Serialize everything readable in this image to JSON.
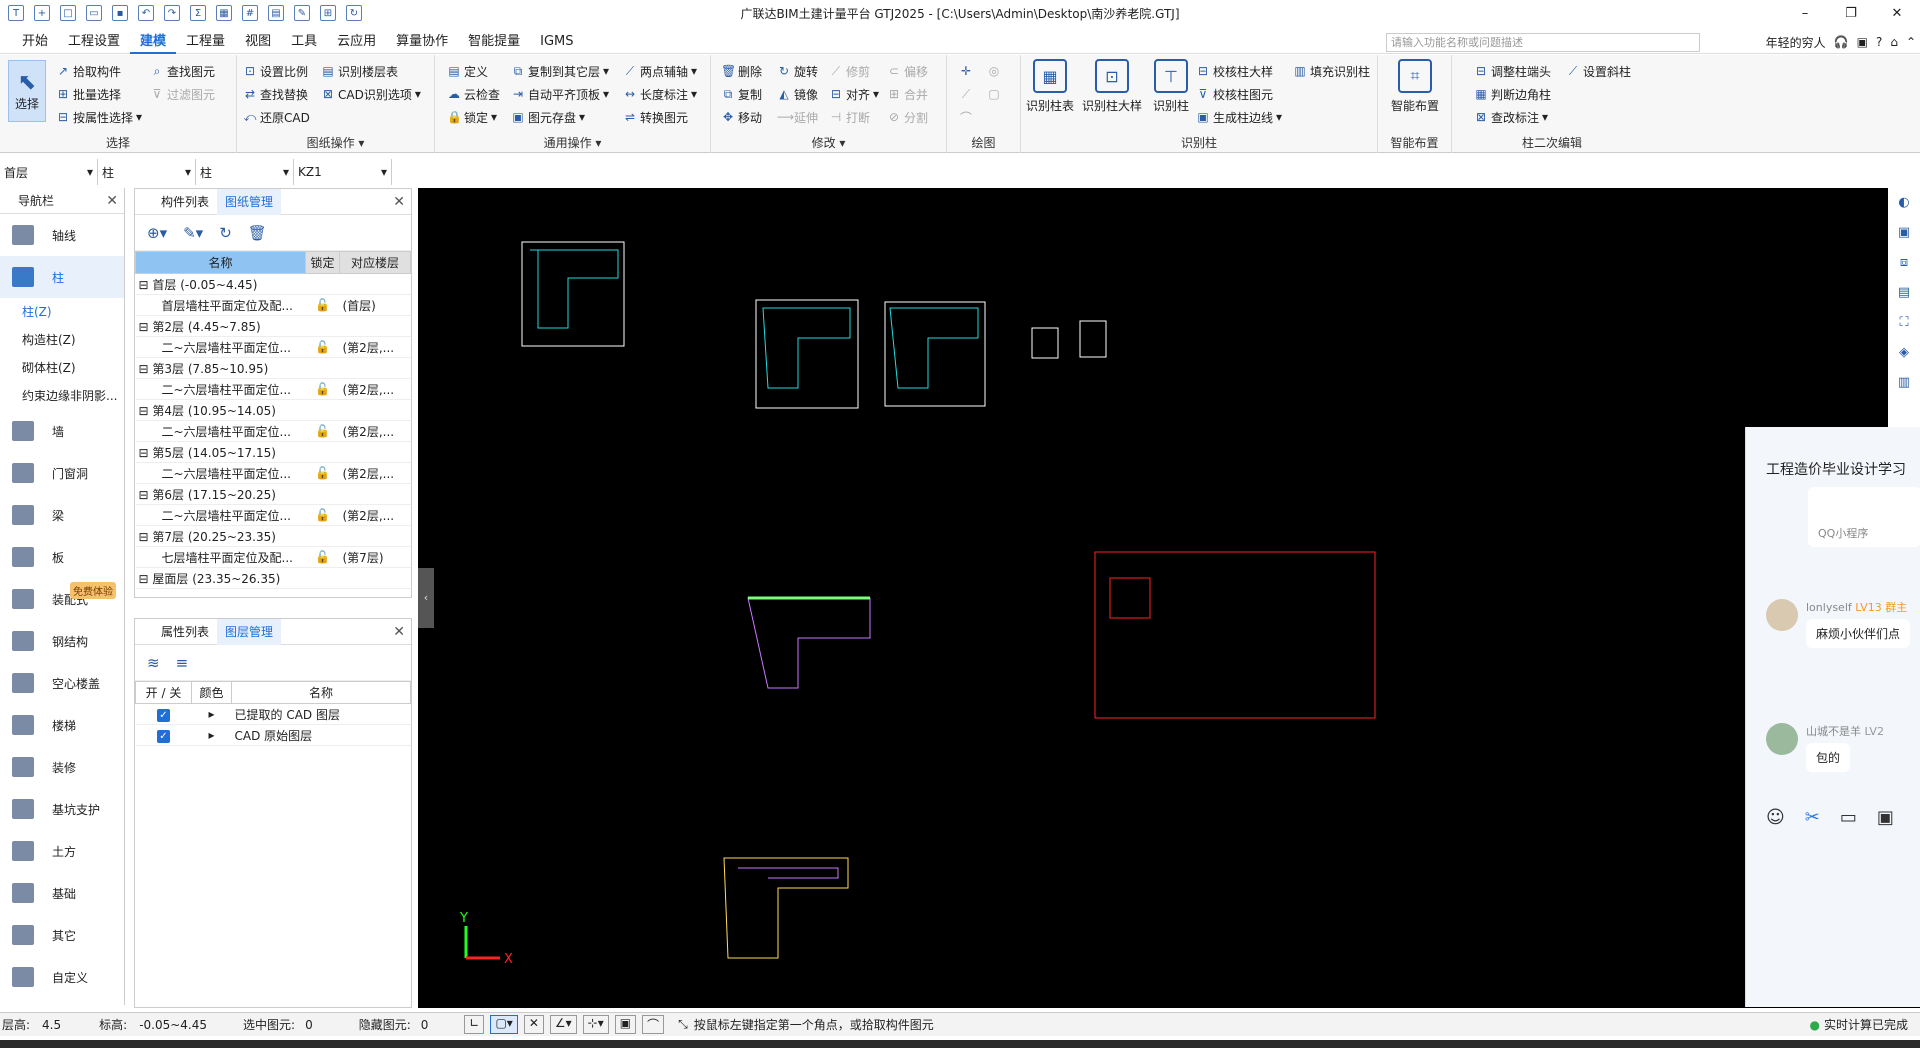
{
  "title": "广联达BIM土建计量平台 GTJ2025 - [C:\\Users\\Admin\\Desktop\\南沙养老院.GTJ]",
  "menu": [
    "开始",
    "工程设置",
    "建模",
    "工程量",
    "视图",
    "工具",
    "云应用",
    "算量协作",
    "智能提量",
    "IGMS"
  ],
  "search_placeholder": "请输入功能名称或问题描述",
  "user_name": "年轻的穷人",
  "ribbon": {
    "select_group": "选择",
    "select_big": "选择",
    "select_items": [
      "拾取构件",
      "批量选择",
      "按属性选择",
      "查找图元",
      "过滤图元"
    ],
    "drawing_group": "图纸操作",
    "drawing_items": [
      "设置比例",
      "识别楼层表",
      "查找替换",
      "CAD识别选项",
      "还原CAD"
    ],
    "common_group": "通用操作",
    "common_items": [
      "定义",
      "复制到其它层",
      "两点辅轴",
      "云检查",
      "自动平齐顶板",
      "长度标注",
      "锁定",
      "图元存盘",
      "转换图元"
    ],
    "modify_group": "修改",
    "modify_items": [
      "删除",
      "旋转",
      "修剪",
      "偏移",
      "复制",
      "镜像",
      "对齐",
      "合并",
      "移动",
      "延伸",
      "打断",
      "分割"
    ],
    "draw_group": "绘图",
    "recog_group": "识别柱",
    "recog_big": [
      "识别柱表",
      "识别柱大样",
      "识别柱"
    ],
    "recog_items": [
      "校核柱大样",
      "填充识别柱",
      "校核柱图元",
      "生成柱边线"
    ],
    "smart_group": "智能布置",
    "smart_big": "智能布置",
    "edit_group": "柱二次编辑",
    "edit_items": [
      "调整柱端头",
      "设置斜柱",
      "判断边角柱",
      "查改标注"
    ]
  },
  "dropdowns": [
    "首层",
    "柱",
    "柱",
    "KZ1"
  ],
  "nav": {
    "title": "导航栏",
    "top": [
      "轴线",
      "柱"
    ],
    "sub": [
      "柱(Z)",
      "构造柱(Z)",
      "砌体柱(Z)",
      "约束边缘非阴影..."
    ],
    "items": [
      "墙",
      "门窗洞",
      "梁",
      "板",
      "装配式",
      "钢结构",
      "空心楼盖",
      "楼梯",
      "装修",
      "基坑支护",
      "土方",
      "基础",
      "其它",
      "自定义"
    ],
    "badge": "免费体验"
  },
  "comp_tabs": [
    "构件列表",
    "图纸管理"
  ],
  "table_headers": [
    "名称",
    "锁定",
    "对应楼层"
  ],
  "table_rows": [
    {
      "name": "首层 (-0.05~4.45)",
      "lock": "",
      "floor": "",
      "group": true
    },
    {
      "name": "首层墙柱平面定位及配...",
      "lock": "🔓",
      "floor": "(首层)",
      "group": false
    },
    {
      "name": "第2层 (4.45~7.85)",
      "lock": "",
      "floor": "",
      "group": true
    },
    {
      "name": "二~六层墙柱平面定位...",
      "lock": "🔓",
      "floor": "(第2层,...",
      "group": false
    },
    {
      "name": "第3层 (7.85~10.95)",
      "lock": "",
      "floor": "",
      "group": true
    },
    {
      "name": "二~六层墙柱平面定位...",
      "lock": "🔓",
      "floor": "(第2层,...",
      "group": false
    },
    {
      "name": "第4层 (10.95~14.05)",
      "lock": "",
      "floor": "",
      "group": true
    },
    {
      "name": "二~六层墙柱平面定位...",
      "lock": "🔓",
      "floor": "(第2层,...",
      "group": false
    },
    {
      "name": "第5层 (14.05~17.15)",
      "lock": "",
      "floor": "",
      "group": true
    },
    {
      "name": "二~六层墙柱平面定位...",
      "lock": "🔓",
      "floor": "(第2层,...",
      "group": false
    },
    {
      "name": "第6层 (17.15~20.25)",
      "lock": "",
      "floor": "",
      "group": true
    },
    {
      "name": "二~六层墙柱平面定位...",
      "lock": "🔓",
      "floor": "(第2层,...",
      "group": false
    },
    {
      "name": "第7层 (20.25~23.35)",
      "lock": "",
      "floor": "",
      "group": true
    },
    {
      "name": "七层墙柱平面定位及配...",
      "lock": "🔓",
      "floor": "(第7层)",
      "group": false
    },
    {
      "name": "屋面层 (23.35~26.35)",
      "lock": "",
      "floor": "",
      "group": true
    }
  ],
  "prop_tabs": [
    "属性列表",
    "图层管理"
  ],
  "layer_headers": [
    "开 / 关",
    "颜色",
    "名称"
  ],
  "layers": [
    "已提取的 CAD 图层",
    "CAD 原始图层"
  ],
  "chat": {
    "title": "工程造价毕业设计学习",
    "mini": "QQ小程序",
    "msg1_user": "lonlyself",
    "msg1_badge": "LV13 群主",
    "msg1_text": "麻烦小伙伴们点",
    "msg2_user": "山城不是羊",
    "msg2_badge": "LV2",
    "msg2_text": "包的"
  },
  "status": {
    "floor_h": "层高:",
    "floor_h_val": "4.5",
    "elev": "标高:",
    "elev_val": "-0.05~4.45",
    "sel": "选中图元:",
    "sel_val": "0",
    "hid": "隐藏图元:",
    "hid_val": "0",
    "hint": "按鼠标左键指定第一个角点，或拾取构件图元",
    "calc": "实时计算已完成"
  },
  "axis": {
    "x": "X",
    "y": "Y"
  }
}
